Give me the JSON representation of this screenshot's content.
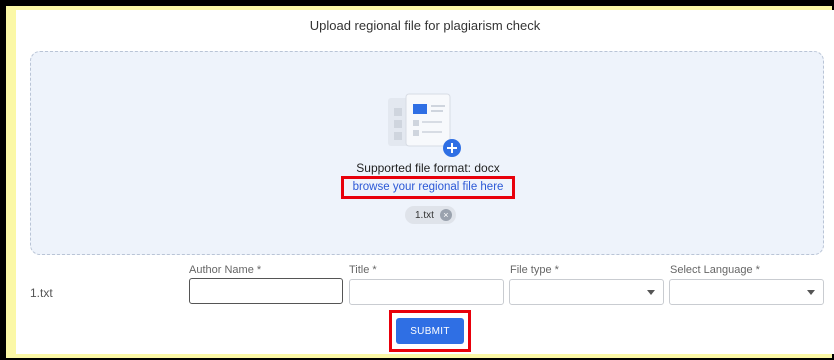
{
  "page": {
    "title": "Upload regional file for plagiarism check"
  },
  "dropzone": {
    "format_text": "Supported file format: docx",
    "browse_text": "browse your regional file here",
    "chip_label": "1.txt",
    "chip_remove": "×",
    "icon": "document-upload-icon"
  },
  "row": {
    "file_name": "1.txt",
    "author_label": "Author Name *",
    "title_label": "Title *",
    "filetype_label": "File type *",
    "language_label": "Select Language *",
    "author_value": "",
    "title_value": "",
    "filetype_value": "",
    "language_value": ""
  },
  "actions": {
    "submit_label": "SUBMIT"
  },
  "colors": {
    "accent": "#2f6fe4",
    "highlight": "#e8000b",
    "background": "#fbf8a6"
  }
}
